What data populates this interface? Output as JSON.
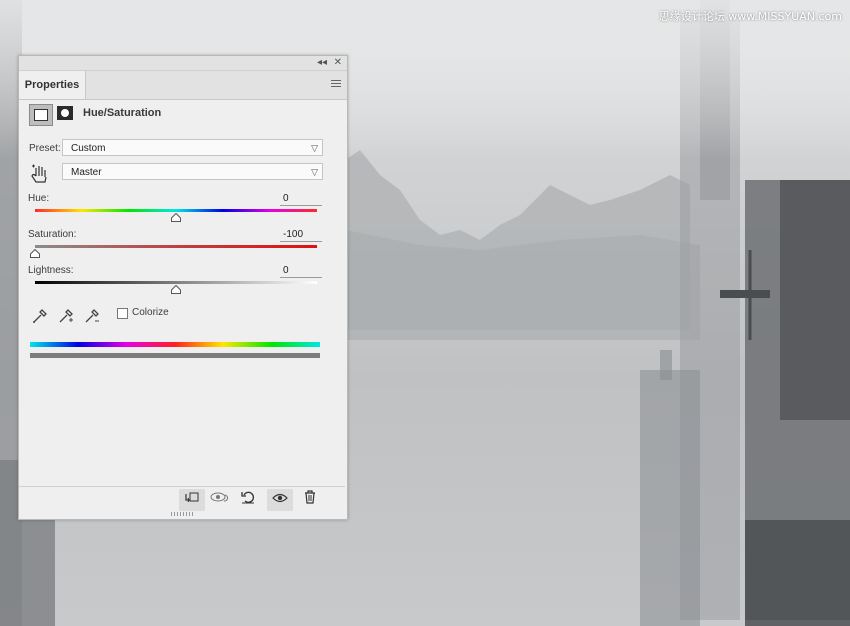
{
  "watermark": "思缘设计论坛 www.MISSYUAN.com",
  "panel": {
    "tab_label": "Properties",
    "adjustment_title": "Hue/Saturation",
    "preset_label": "Preset:",
    "preset_value": "Custom",
    "channel_value": "Master",
    "hue_label": "Hue:",
    "hue_value": "0",
    "saturation_label": "Saturation:",
    "saturation_value": "-100",
    "lightness_label": "Lightness:",
    "lightness_value": "0",
    "colorize_label": "Colorize",
    "colorize_checked": false
  },
  "sliders": {
    "hue": 0,
    "saturation": -100,
    "lightness": 0
  },
  "icons": {
    "collapse": "double-chevron-left-icon",
    "close": "close-icon",
    "menu": "panel-menu-icon",
    "adjustment": "hue-saturation-adjustment-icon",
    "mask": "layer-mask-icon",
    "target_adjust": "hand-target-adjust-icon",
    "eyedropper": "eyedropper-icon",
    "eyedropper_add": "eyedropper-plus-icon",
    "eyedropper_subtract": "eyedropper-minus-icon",
    "clip": "clip-to-layer-icon",
    "view_previous": "view-previous-state-icon",
    "reset": "reset-icon",
    "visibility": "eye-icon",
    "delete": "trash-icon"
  }
}
